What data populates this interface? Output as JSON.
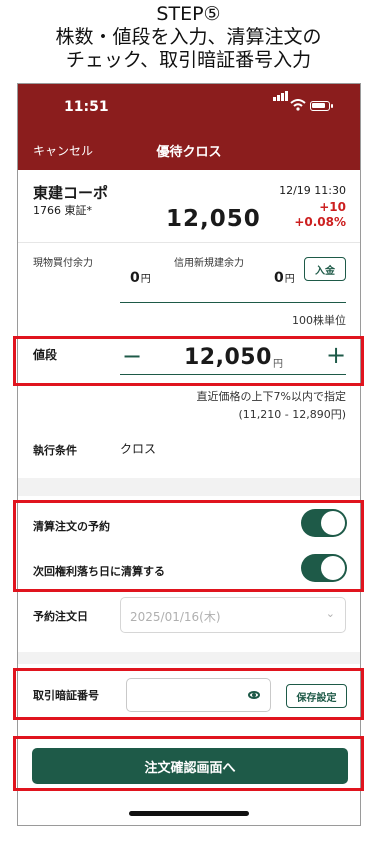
{
  "caption": {
    "line1": "STEP⑤",
    "line2": "株数・値段を入力、清算注文の",
    "line3": "チェック、取引暗証番号入力"
  },
  "status_bar": {
    "time": "11:51"
  },
  "nav": {
    "cancel_label": "キャンセル",
    "title": "優待クロス"
  },
  "stock": {
    "name": "東建コーポ",
    "code_market": "1766  東証*",
    "datetime": "12/19 11:30",
    "price": "12,050",
    "change": "+10",
    "change_pct": "+0.08%",
    "change_color": "#cc1f1f"
  },
  "balances": {
    "cash_label": "現物買付余力",
    "cash_value": "0",
    "credit_label": "信用新規建余力",
    "credit_value": "0",
    "unit": "円",
    "deposit_label": "入金"
  },
  "order": {
    "unit_note": "100株単位",
    "price_label": "値段",
    "minus_symbol": "−",
    "plus_symbol": "+",
    "price_value": "12,050",
    "price_unit": "円",
    "range_note": "直近価格の上下7%以内で指定",
    "range_values": "(11,210 - 12,890円)",
    "condition_label": "執行条件",
    "condition_value": "クロス"
  },
  "settlement": {
    "reserve_label": "清算注文の予約",
    "reserve_on": true,
    "next_rights_label": "次回権利落ち日に清算する",
    "next_rights_on": true,
    "date_label": "予約注文日",
    "date_value": "2025/01/16(木)"
  },
  "pin": {
    "label": "取引暗証番号",
    "save_label": "保存設定"
  },
  "confirm_label": "注文確認画面へ",
  "colors": {
    "brand": "#8b1d1d",
    "accent": "#1e5a48",
    "highlight": "#e0141e"
  }
}
